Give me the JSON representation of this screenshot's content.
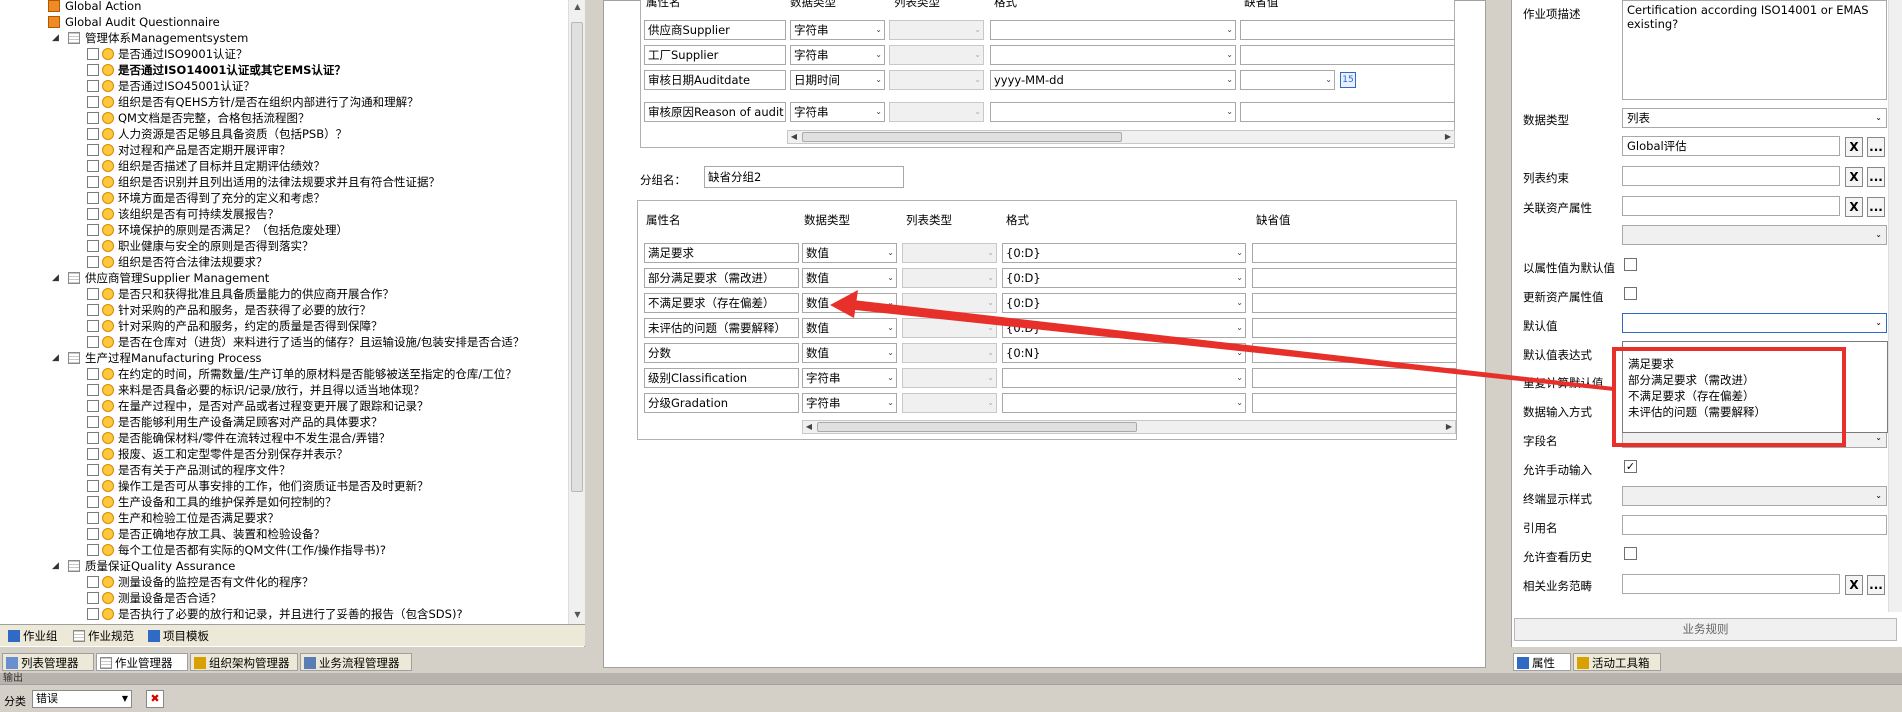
{
  "tree": {
    "items": [
      {
        "label": "Global Action",
        "icon": "folder-icon"
      },
      {
        "label": "Global Audit Questionnaire",
        "icon": "folder-icon"
      },
      {
        "label": "管理体系Managementsystem",
        "icon": "sheet-icon"
      },
      {
        "label": "是否通过ISO9001认证？",
        "icon": "doc-icon"
      },
      {
        "label": "是否通过ISO14001认证或其它EMS认证？",
        "icon": "doc-icon"
      },
      {
        "label": "是否通过ISO45001认证？",
        "icon": "doc-icon"
      },
      {
        "label": "组织是否有QEHS方针/是否在组织内部进行了沟通和理解？",
        "icon": "doc-icon"
      },
      {
        "label": "QM文档是否完整，合格包括流程图？",
        "icon": "doc-icon"
      },
      {
        "label": "人力资源是否足够且具备资质（包括PSB）？",
        "icon": "doc-icon"
      },
      {
        "label": "对过程和产品是否定期开展评审？",
        "icon": "doc-icon"
      },
      {
        "label": "组织是否描述了目标并且定期评估绩效？",
        "icon": "doc-icon"
      },
      {
        "label": "组织是否识别并且列出适用的法律法规要求并且有符合性证据？",
        "icon": "doc-icon"
      },
      {
        "label": "环境方面是否得到了充分的定义和考虑？",
        "icon": "doc-icon"
      },
      {
        "label": "该组织是否有可持续发展报告？",
        "icon": "doc-icon"
      },
      {
        "label": "环境保护的原则是否满足？（包括危废处理）",
        "icon": "doc-icon"
      },
      {
        "label": "职业健康与安全的原则是否得到落实？",
        "icon": "doc-icon"
      },
      {
        "label": "组织是否符合法律法规要求？",
        "icon": "doc-icon"
      },
      {
        "label": "供应商管理Supplier Management",
        "icon": "sheet-icon"
      },
      {
        "label": "是否只和获得批准且具备质量能力的供应商开展合作？",
        "icon": "doc-icon"
      },
      {
        "label": "针对采购的产品和服务，是否获得了必要的放行？",
        "icon": "doc-icon"
      },
      {
        "label": "针对采购的产品和服务，约定的质量是否得到保障？",
        "icon": "doc-icon"
      },
      {
        "label": "是否在仓库对（进货）来料进行了适当的储存？且运输设施/包装安排是否合适？",
        "icon": "doc-icon"
      },
      {
        "label": "生产过程Manufacturing Process",
        "icon": "sheet-icon"
      },
      {
        "label": "在约定的时间，所需数量/生产订单的原材料是否能够被送至指定的仓库/工位？",
        "icon": "doc-icon"
      },
      {
        "label": "来料是否具备必要的标识/记录/放行，并且得以适当地体现？",
        "icon": "doc-icon"
      },
      {
        "label": "在量产过程中，是否对产品或者过程变更开展了跟踪和记录？",
        "icon": "doc-icon"
      },
      {
        "label": "是否能够利用生产设备满足顾客对产品的具体要求？",
        "icon": "doc-icon"
      },
      {
        "label": "是否能确保材料/零件在流转过程中不发生混合/弄错？",
        "icon": "doc-icon"
      },
      {
        "label": "报废、返工和定型零件是否分别保存并表示？",
        "icon": "doc-icon"
      },
      {
        "label": "是否有关于产品测试的程序文件？",
        "icon": "doc-icon"
      },
      {
        "label": "操作工是否可从事安排的工作，他们资质证书是否及时更新？",
        "icon": "doc-icon"
      },
      {
        "label": "生产设备和工具的维护保养是如何控制的？",
        "icon": "doc-icon"
      },
      {
        "label": "生产和检验工位是否满足要求？",
        "icon": "doc-icon"
      },
      {
        "label": "是否正确地存放工具、装置和检验设备？",
        "icon": "doc-icon"
      },
      {
        "label": "每个工位是否都有实际的QM文件(工作/操作指导书)?",
        "icon": "doc-icon"
      },
      {
        "label": "质量保证Quality Assurance",
        "icon": "sheet-icon"
      },
      {
        "label": "测量设备的监控是否有文件化的程序？",
        "icon": "doc-icon"
      },
      {
        "label": "测量设备是否合适？",
        "icon": "doc-icon"
      },
      {
        "label": "是否执行了必要的放行和记录，并且进行了妥善的报告（包含SDS)?",
        "icon": "doc-icon"
      }
    ]
  },
  "bottom_tabs_top": [
    "作业组",
    "作业规范",
    "项目模板"
  ],
  "bottom_tabs": [
    "列表管理器",
    "作业管理器",
    "组织架构管理器",
    "业务流程管理器"
  ],
  "grid1": {
    "headers": [
      "属性名",
      "数据类型",
      "列表类型",
      "格式",
      "缺省值"
    ],
    "rows": [
      {
        "name": "供应商Supplier",
        "type": "字符串",
        "fmt": "",
        "def": ""
      },
      {
        "name": "工厂Supplier",
        "type": "字符串",
        "fmt": "",
        "def": ""
      },
      {
        "name": "审核日期Auditdate",
        "type": "日期时间",
        "fmt": "yyyy-MM-dd",
        "def": ""
      },
      {
        "name": "审核原因Reason of audit",
        "type": "字符串",
        "fmt": "",
        "def": ""
      }
    ]
  },
  "group": {
    "label": "分组名：",
    "value": "缺省分组2"
  },
  "grid2": {
    "headers": [
      "属性名",
      "数据类型",
      "列表类型",
      "格式",
      "缺省值"
    ],
    "rows": [
      {
        "name": "满足要求",
        "type": "数值",
        "fmt": "{0:D}"
      },
      {
        "name": "部分满足要求（需改进）",
        "type": "数值",
        "fmt": "{0:D}"
      },
      {
        "name": "不满足要求（存在偏差）",
        "type": "数值",
        "fmt": "{0:D}"
      },
      {
        "name": "未评估的问题（需要解释）",
        "type": "数值",
        "fmt": "{0:D}"
      },
      {
        "name": "分数",
        "type": "数值",
        "fmt": "{0:N}"
      },
      {
        "name": "级别Classification",
        "type": "字符串",
        "fmt": ""
      },
      {
        "name": "分级Gradation",
        "type": "字符串",
        "fmt": ""
      }
    ]
  },
  "props": {
    "desc_label": "作业项描述",
    "desc_value": "Certification according ISO14001 or EMAS existing?",
    "datatype_label": "数据类型",
    "datatype_value": "列表",
    "list_value": "Global评估",
    "list_constraint_label": "列表约束",
    "asset_attr_label": "关联资产属性",
    "use_attr_default_label": "以属性值为默认值",
    "update_asset_label": "更新资产属性值",
    "default_label": "默认值",
    "default_expr_label": "默认值表达式",
    "recalc_label": "重复计算默认值",
    "input_mode_label": "数据输入方式",
    "field_name_label": "字段名",
    "allow_manual_label": "允许手动输入",
    "terminal_style_label": "终端显示样式",
    "ref_name_label": "引用名",
    "allow_history_label": "允许查看历史",
    "biz_scope_label": "相关业务范畴",
    "biz_rule_button": "业务规则",
    "x_button": "X",
    "more_button": "...",
    "dropdown_options": [
      "满足要求",
      "部分满足要求（需改进）",
      "不满足要求（存在偏差）",
      "未评估的问题（需要解释）"
    ]
  },
  "right_tabs": [
    "属性",
    "活动工具箱"
  ],
  "output": {
    "label": "输出",
    "filter_label": "分类",
    "filter_value": "错误"
  },
  "colors": {
    "accent": "#316ac5",
    "annotation": "#e8302a"
  }
}
